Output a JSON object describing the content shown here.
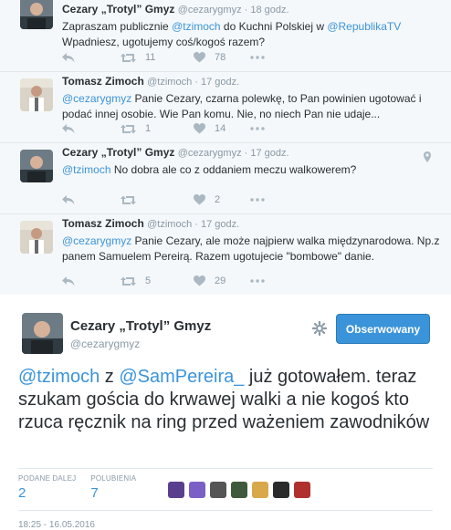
{
  "thread": [
    {
      "name": "Cezary „Trotyl” Gmyz",
      "handle": "@cezarygmyz",
      "time": "18 godz.",
      "text": [
        {
          "t": "Zapraszam publicznie ",
          "link": false
        },
        {
          "t": "@tzimoch",
          "link": true
        },
        {
          "t": " do Kuchni Polskiej w ",
          "link": false
        },
        {
          "t": "@RepublikaTV",
          "link": true
        },
        {
          "t": " Wpadniesz, ugotujemy coś/kogoś razem?",
          "link": false
        }
      ],
      "retweets": "11",
      "likes": "78"
    },
    {
      "name": "Tomasz Zimoch",
      "handle": "@tzimoch",
      "time": "17 godz.",
      "text": [
        {
          "t": "@cezarygmyz",
          "link": true
        },
        {
          "t": " Panie Cezary, czarna polewkę, to Pan powinien ugotować i podać innej osobie. Wie Pan komu. Nie, no niech Pan nie udaje...",
          "link": false
        }
      ],
      "retweets": "1",
      "likes": "14"
    },
    {
      "name": "Cezary „Trotyl” Gmyz",
      "handle": "@cezarygmyz",
      "time": "17 godz.",
      "text": [
        {
          "t": "@tzimoch",
          "link": true
        },
        {
          "t": " No dobra ale co z oddaniem meczu walkowerem?",
          "link": false
        }
      ],
      "retweets": "",
      "likes": "2"
    },
    {
      "name": "Tomasz Zimoch",
      "handle": "@tzimoch",
      "time": "17 godz.",
      "text": [
        {
          "t": "@cezarygmyz",
          "link": true
        },
        {
          "t": " Panie Cezary, ale może najpierw walka międzynarodowa. Np.z panem Samuelem Pereirą. Razem ugotujecie \"bombowe\" danie.",
          "link": false
        }
      ],
      "retweets": "5",
      "likes": "29"
    }
  ],
  "main": {
    "name": "Cezary „Trotyl” Gmyz",
    "handle": "@cezarygmyz",
    "follow_label": "Obserwowany",
    "text": [
      {
        "t": "@tzimoch",
        "link": true
      },
      {
        "t": " z ",
        "link": false
      },
      {
        "t": "@SamPereira_",
        "link": true
      },
      {
        "t": "  już gotowałem. teraz szukam gościa do krwawej walki a nie kogoś kto rzuca ręcznik na ring przed ważeniem zawodników",
        "link": false
      }
    ],
    "retweets_label": "PODANE DALEJ",
    "retweets_value": "2",
    "likes_label": "POLUBIENIA",
    "likes_value": "7",
    "likers": [
      "#5b3f8f",
      "#7b5fc7",
      "#555555",
      "#3f5a3a",
      "#d9a84a",
      "#2b2b2b",
      "#b03030"
    ],
    "date": "18:25 - 16.05.2016"
  },
  "colors": {
    "link": "#3b94d9",
    "muted": "#8899a6",
    "thread_bg": "#f5f8fa"
  }
}
